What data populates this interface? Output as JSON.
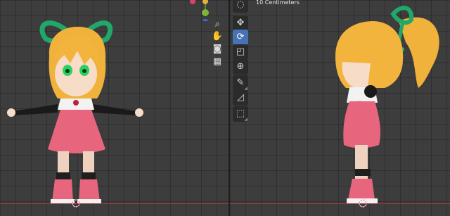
{
  "app": "Blender",
  "viewport_left": {
    "view": "front-orthographic",
    "gizmo_axes": [
      "x",
      "y",
      "z"
    ],
    "nav_buttons": [
      {
        "name": "zoom-icon",
        "glyph": "⌕"
      },
      {
        "name": "hand-icon",
        "glyph": "✋"
      },
      {
        "name": "camera-icon",
        "glyph": "🎥"
      },
      {
        "name": "grid-icon",
        "glyph": "▦"
      }
    ]
  },
  "viewport_right": {
    "view": "right-orthographic",
    "grid_scale_label": "10 Centimeters",
    "tools": [
      {
        "name": "select-tool",
        "glyph": "◌",
        "active": false
      },
      {
        "name": "move-tool",
        "glyph": "✥",
        "active": false
      },
      {
        "name": "rotate-tool",
        "glyph": "⟳",
        "active": true
      },
      {
        "name": "scale-tool",
        "glyph": "◰",
        "active": false
      },
      {
        "name": "transform-tool",
        "glyph": "⊕",
        "active": false
      },
      {
        "name": "annotate-tool",
        "glyph": "✎",
        "active": false
      },
      {
        "name": "measure-tool",
        "glyph": "📐",
        "active": false
      },
      {
        "name": "add-cube-tool",
        "glyph": "⬚",
        "active": false
      }
    ]
  },
  "colors": {
    "grid_bg": "#3d3d3d",
    "x_axis": "#9b3c3c",
    "y_axis": "#6a8c3a",
    "active_tool": "#4772b3",
    "hair": "#f0b23a",
    "dress": "#e8657e",
    "ribbon": "#1fa86a"
  }
}
